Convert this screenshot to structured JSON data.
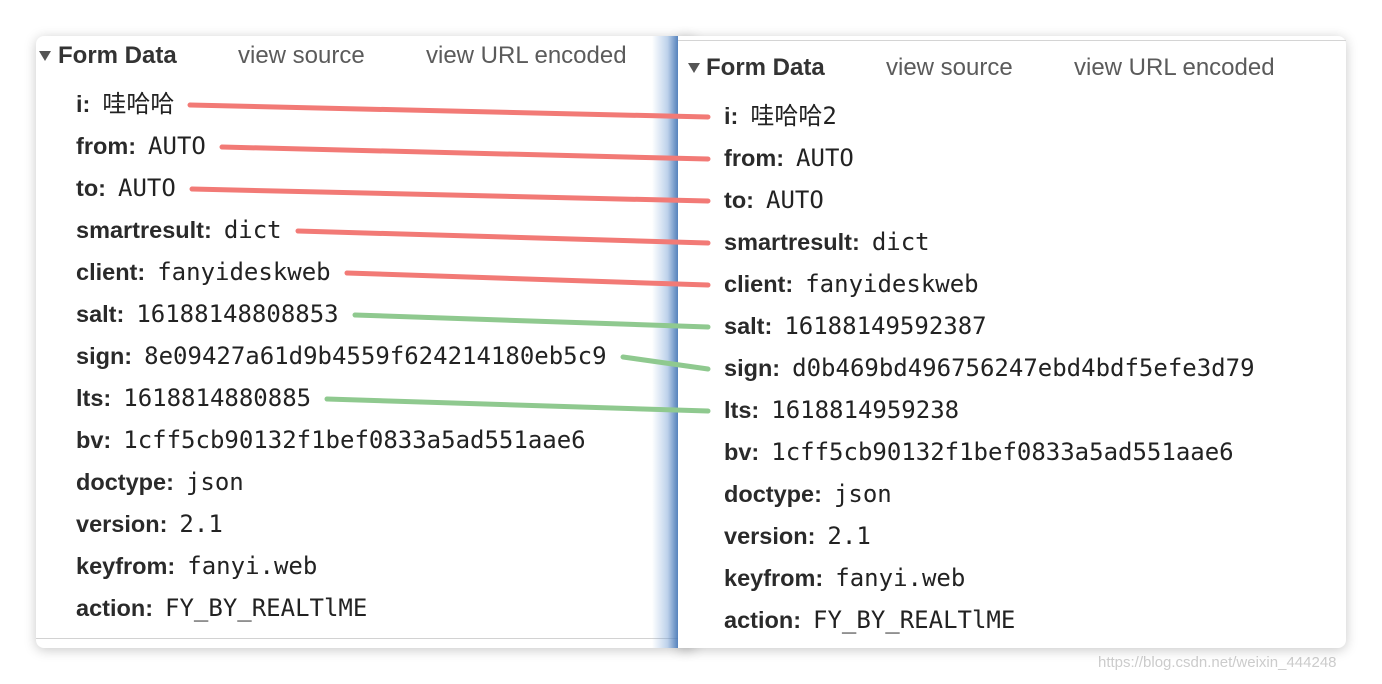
{
  "panels": [
    {
      "header": {
        "toggle_icon": "triangle-down-icon",
        "title": "Form Data",
        "view_source": "view source",
        "view_url_encoded": "view URL encoded"
      },
      "rows": [
        {
          "name": "i:",
          "value": "哇哈哈"
        },
        {
          "name": "from:",
          "value": "AUTO"
        },
        {
          "name": "to:",
          "value": "AUTO"
        },
        {
          "name": "smartresult:",
          "value": "dict"
        },
        {
          "name": "client:",
          "value": "fanyideskweb"
        },
        {
          "name": "salt:",
          "value": "16188148808853"
        },
        {
          "name": "sign:",
          "value": "8e09427a61d9b4559f624214180eb5c9"
        },
        {
          "name": "lts:",
          "value": "1618814880885"
        },
        {
          "name": "bv:",
          "value": "1cff5cb90132f1bef0833a5ad551aae6"
        },
        {
          "name": "doctype:",
          "value": "json"
        },
        {
          "name": "version:",
          "value": "2.1"
        },
        {
          "name": "keyfrom:",
          "value": "fanyi.web"
        },
        {
          "name": "action:",
          "value": "FY_BY_REALTlME"
        }
      ]
    },
    {
      "header": {
        "toggle_icon": "triangle-down-icon",
        "title": "Form Data",
        "view_source": "view source",
        "view_url_encoded": "view URL encoded"
      },
      "rows": [
        {
          "name": "i:",
          "value": "哇哈哈2"
        },
        {
          "name": "from:",
          "value": "AUTO"
        },
        {
          "name": "to:",
          "value": "AUTO"
        },
        {
          "name": "smartresult:",
          "value": "dict"
        },
        {
          "name": "client:",
          "value": "fanyideskweb"
        },
        {
          "name": "salt:",
          "value": "16188149592387"
        },
        {
          "name": "sign:",
          "value": "d0b469bd496756247ebd4bdf5efe3d79"
        },
        {
          "name": "lts:",
          "value": "1618814959238"
        },
        {
          "name": "bv:",
          "value": "1cff5cb90132f1bef0833a5ad551aae6"
        },
        {
          "name": "doctype:",
          "value": "json"
        },
        {
          "name": "version:",
          "value": "2.1"
        },
        {
          "name": "keyfrom:",
          "value": "fanyi.web"
        },
        {
          "name": "action:",
          "value": "FY_BY_REALTlME"
        }
      ]
    }
  ],
  "connector_colors": [
    "#f27a76",
    "#f27a76",
    "#f27a76",
    "#f27a76",
    "#f27a76",
    "#8fc98f",
    "#8fc98f",
    "#8fc98f"
  ],
  "watermark": "https://blog.csdn.net/weixin_444248"
}
